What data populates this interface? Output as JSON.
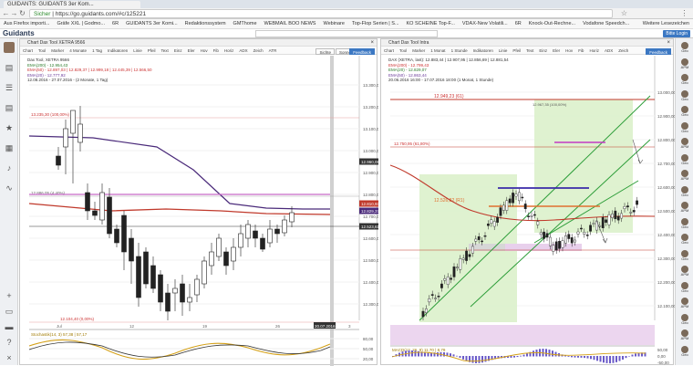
{
  "browser": {
    "tab_title": "GUIDANTS: GUIDANTS 3er Kom...",
    "url_secure": "Sicher",
    "url": "https://go.guidants.com/#c/125221",
    "bookmarks": [
      "Aus Firefox importi...",
      "Gräfe XXL | Godmo...",
      "6R",
      "GUIDANTS 3er Komi...",
      "Redaktionssystem",
      "GMThome",
      "WEBMAIL BOO NEWS",
      "Webinare",
      "Top-Flop Serien | S...",
      "KO SCHEINE Top-F...",
      "VDAX-New Volatili...",
      "6R",
      "Knock-Out-Rechne...",
      "Vodafone Speedch..."
    ],
    "bookmarks_more": "Weitere Lesezeichen"
  },
  "app": {
    "logo": "Guidants",
    "search_placeholder": "",
    "login": "Bitte Login"
  },
  "icons": {
    "left": [
      "avatar",
      "chart-icon",
      "list-icon",
      "chart-icon",
      "star-icon",
      "grid-icon",
      "bell-icon",
      "pulse-icon",
      "plus-icon",
      "book-icon",
      "folder-icon",
      "help-icon",
      "close-icon"
    ],
    "right_labels": [
      "Geo",
      "APM",
      "Geo",
      "Geo",
      "Geo",
      "Geo",
      "APM",
      "Geo",
      "APM",
      "Geo",
      "APM",
      "Geo",
      "Geo",
      "Geo",
      "APM",
      "Geo",
      "APM",
      "Geo",
      "APM",
      "Geo"
    ]
  },
  "panel1": {
    "title": "Chart Dax Tool XETRA 9566",
    "toolbar": [
      "Chart",
      "Tool",
      "Marker",
      "4 Monate",
      "1 Tag",
      "Indikatoren",
      "Linie",
      "Pfeil",
      "Text",
      "Einz",
      "Eler",
      "Hov",
      "Fib",
      "Horiz",
      "ADX",
      "Zeich",
      "ATR"
    ],
    "btn_settings": "Sichte",
    "btn_drawing": "Sonne",
    "btn_feedback": "Feedback",
    "legend": [
      "Dax Tool, XETRA 9566",
      "EMA(200) - 12.954,43",
      "EMA(50) - 12.897,03 | 12.829,37 | 12.999,18 | 12.445,39 | 12.566,50",
      "EMA(20) - 12.777,92",
      "12.08.2016 - 27.07.2016 - (2 Monate, 1 Tag)"
    ],
    "price_labels": [
      "13.300,00",
      "13.200,00",
      "13.100,00",
      "13.000,00",
      "12.900,00",
      "12.800,00",
      "12.700,00",
      "12.600,00",
      "12.500,00",
      "12.400,00",
      "12.300,00"
    ],
    "current_price": "12.523,61",
    "marker_price": "12.960,08",
    "annotation_top": "13.235,30 (100,00%)",
    "annotation_bottom": "12.104,40 (0,00%)",
    "annotation_mid": "12.886,05 (4,40%)",
    "osc_label": "Stochastik(14, 3) 57,38 | 57,17",
    "osc_levels": [
      "80,00",
      "50,00",
      "20,00"
    ],
    "date_label": "20.07.2016",
    "x_ticks": [
      "Jul",
      "12",
      "19",
      "26",
      "3"
    ]
  },
  "panel2": {
    "title": "Chart Dax Tool Intra",
    "toolbar": [
      "Chart",
      "Tool",
      "Marker",
      "1 Monat",
      "1 Stunde",
      "Indikatoren",
      "Linie",
      "Pfeil",
      "Text",
      "Einz",
      "Eler",
      "Hov",
      "Fib",
      "Horiz",
      "ADX",
      "Zeich"
    ],
    "btn_feedback": "Feedback",
    "legend": [
      "DAX (XETRA, last): 12.883,44 | 12.907,95 | 12.856,69 | 12.881,54",
      "EMA(200) - 12.799,43",
      "EMA(20) - 12.829,07",
      "EMA(50) - 12.863,44",
      "20.06.2016 16:00 - 17.07.2016 18:00 (1 Monat, 1 Stunde)"
    ],
    "annotation_top": "12.949,23 (61)",
    "annotation_mid": "12.526,82 (R1)",
    "annotation_small": "12.750,95 (61,80%)",
    "annotation_right": "12.967,35 (100,00%)",
    "current_price": "12.881,54",
    "marker_price": "12.963,73",
    "price_labels": [
      "13.000,00",
      "12.900,00",
      "12.800,00",
      "12.700,00",
      "12.600,00",
      "12.500,00",
      "12.400,00",
      "12.300,00",
      "12.200,00",
      "12.100,00"
    ],
    "red_price": "12.455,00",
    "osc_label": "MACD(12, 26, 9) 11,70 | 8,79",
    "osc_levels": [
      "50,00",
      "0,00",
      "-50,00"
    ]
  }
}
